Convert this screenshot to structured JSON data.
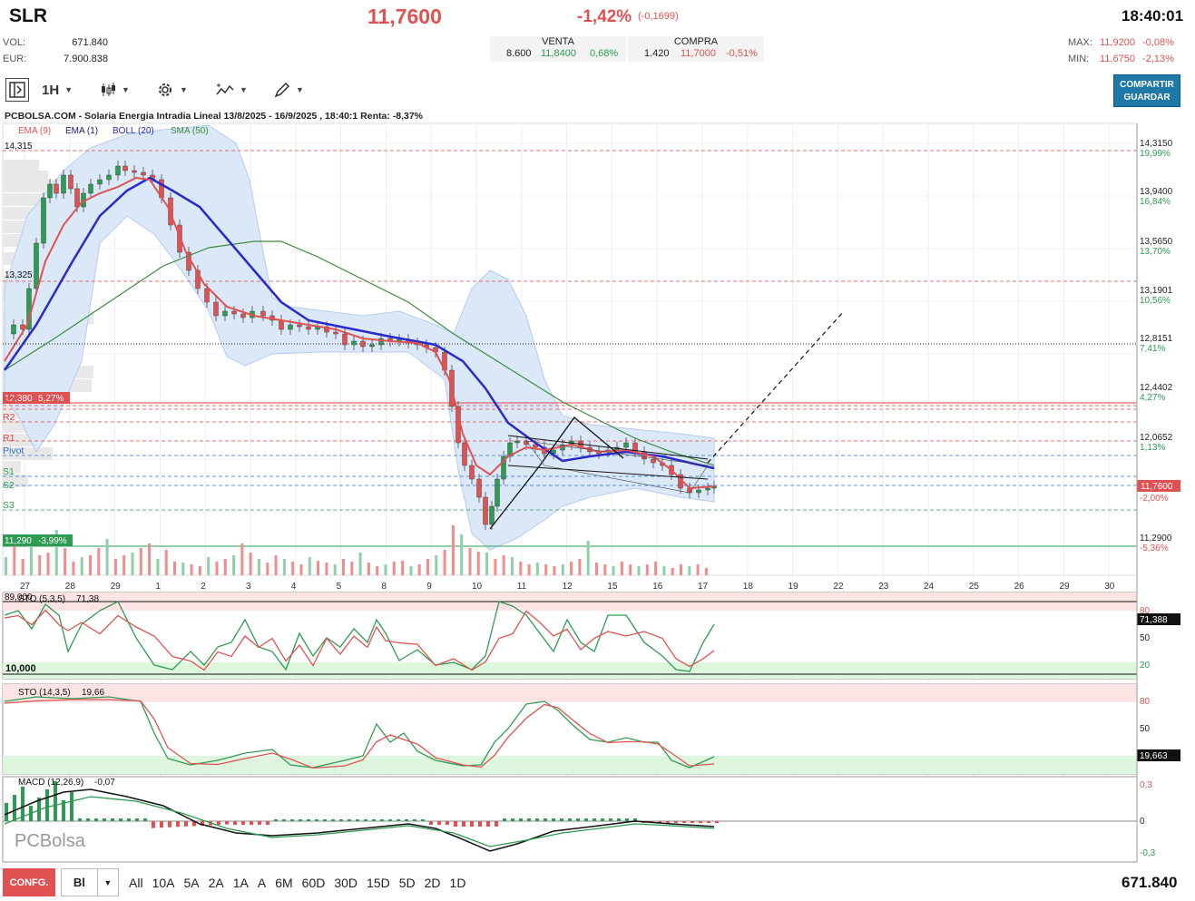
{
  "header": {
    "ticker": "SLR",
    "price": "11,7600",
    "change_pct": "-1,42%",
    "change_abs": "(-0,1699)",
    "time": "18:40:01",
    "vol_label": "VOL:",
    "vol_value": "671.840",
    "eur_label": "EUR:",
    "eur_value": "7.900.838",
    "venta_label": "VENTA",
    "venta_qty": "8.600",
    "venta_price": "11,8400",
    "venta_pct": "0,68%",
    "compra_label": "COMPRA",
    "compra_qty": "1.420",
    "compra_price": "11,7000",
    "compra_pct": "-0,51%",
    "max_label": "MAX:",
    "max_price": "11,9200",
    "max_pct": "-0,08%",
    "min_label": "MIN:",
    "min_price": "11,6750",
    "min_pct": "-2,13%"
  },
  "toolbar": {
    "interval": "1H",
    "share_line1": "COMPARTIR",
    "share_line2": "GUARDAR"
  },
  "chart": {
    "title": "PCBOLSA.COM - Solaria Energia Intradia Lineal 13/8/2025 - 16/9/2025 , 18:40:1 Renta: -8,37%",
    "legend": [
      {
        "label": "EMA (9)",
        "color": "#e05252"
      },
      {
        "label": "EMA (1)",
        "color": "#1a1a7a"
      },
      {
        "label": "BOLL (20)",
        "color": "#2a2acc"
      },
      {
        "label": "SMA (50)",
        "color": "#3d8a3d"
      }
    ],
    "high_label": "14,315",
    "level_13325": "13,325",
    "level_12380": "12,380",
    "level_12380_pct": "5,27%",
    "level_11290": "11,290",
    "level_11290_pct": "-3,99%",
    "pivot_labels": [
      "R3",
      "R2",
      "R1",
      "Pivot",
      "S1",
      "S2",
      "S3"
    ],
    "price_axis": [
      {
        "price": "14,3150",
        "pct": "19,99%"
      },
      {
        "price": "13,9400",
        "pct": "16,84%"
      },
      {
        "price": "13,5650",
        "pct": "13,70%"
      },
      {
        "price": "13,1901",
        "pct": "10,56%"
      },
      {
        "price": "12,8151",
        "pct": "7,41%"
      },
      {
        "price": "12,4402",
        "pct": "4,27%"
      },
      {
        "price": "12,0652",
        "pct": "1,13%"
      },
      {
        "price": "11,2900",
        "pct": "-5,36%"
      }
    ],
    "last_price": "11,7600",
    "last_pct": "-2,00%",
    "dates": [
      "27",
      "28",
      "29",
      "1",
      "2",
      "3",
      "4",
      "5",
      "8",
      "9",
      "10",
      "11",
      "12",
      "15",
      "16",
      "17",
      "18",
      "19",
      "22",
      "23",
      "24",
      "25",
      "26",
      "29",
      "30"
    ],
    "colors": {
      "up": "#2e9b52",
      "down": "#e05252",
      "boll_fill": "#d8e6f7",
      "boll_line": "#b8cbef"
    }
  },
  "indicators": {
    "sto1_label": "STO (5,3,5)",
    "sto1_value": "71,38",
    "sto1_top": "89,000",
    "sto1_bottom": "10,000",
    "sto1_last": "71,388",
    "sto1_axis": [
      "80",
      "50",
      "20"
    ],
    "sto2_label": "STO (14,3,5)",
    "sto2_value": "19,66",
    "sto2_last": "19,663",
    "sto2_axis": [
      "80",
      "50"
    ],
    "macd_label": "MACD (12,26,9)",
    "macd_value": "-0,07",
    "macd_axis": [
      "0,3",
      "0",
      "-0,3"
    ],
    "logo": "PCBolsa"
  },
  "footer": {
    "config": "CONFG.",
    "mode": "Bl",
    "ranges": [
      "All",
      "10A",
      "5A",
      "2A",
      "1A",
      "A",
      "6M",
      "60D",
      "30D",
      "15D",
      "5D",
      "2D",
      "1D"
    ],
    "volume": "671.840"
  }
}
